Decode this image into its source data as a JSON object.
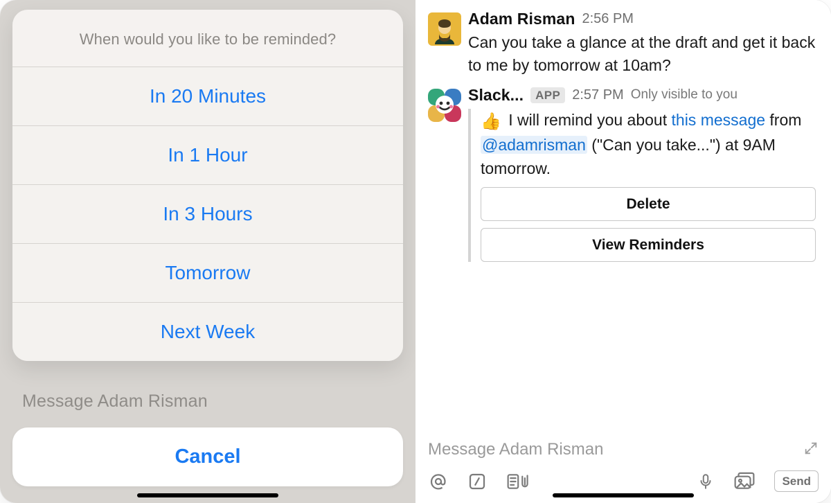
{
  "left": {
    "dimmed_message_placeholder": "Message Adam Risman",
    "sheet": {
      "title": "When would you like to be reminded?",
      "options": [
        "In 20 Minutes",
        "In 1 Hour",
        "In 3 Hours",
        "Tomorrow",
        "Next Week"
      ],
      "cancel_label": "Cancel"
    }
  },
  "right": {
    "messages": {
      "user": {
        "name": "Adam Risman",
        "time": "2:56 PM",
        "text": "Can you take a glance at the draft and get it back to me by tomorrow at 10am?"
      },
      "bot": {
        "name": "Slack...",
        "badge": "APP",
        "time": "2:57 PM",
        "visibility_note": "Only visible to you",
        "emoji": "👍",
        "text_prefix": " I will remind you about ",
        "link_text": "this message",
        "text_mid": " from ",
        "mention": "@adamrisman",
        "text_suffix": " (\"Can you take...\") at 9AM tomorrow.",
        "delete_label": "Delete",
        "view_label": "View Reminders"
      }
    },
    "composer": {
      "placeholder": "Message Adam Risman",
      "send_label": "Send"
    }
  }
}
